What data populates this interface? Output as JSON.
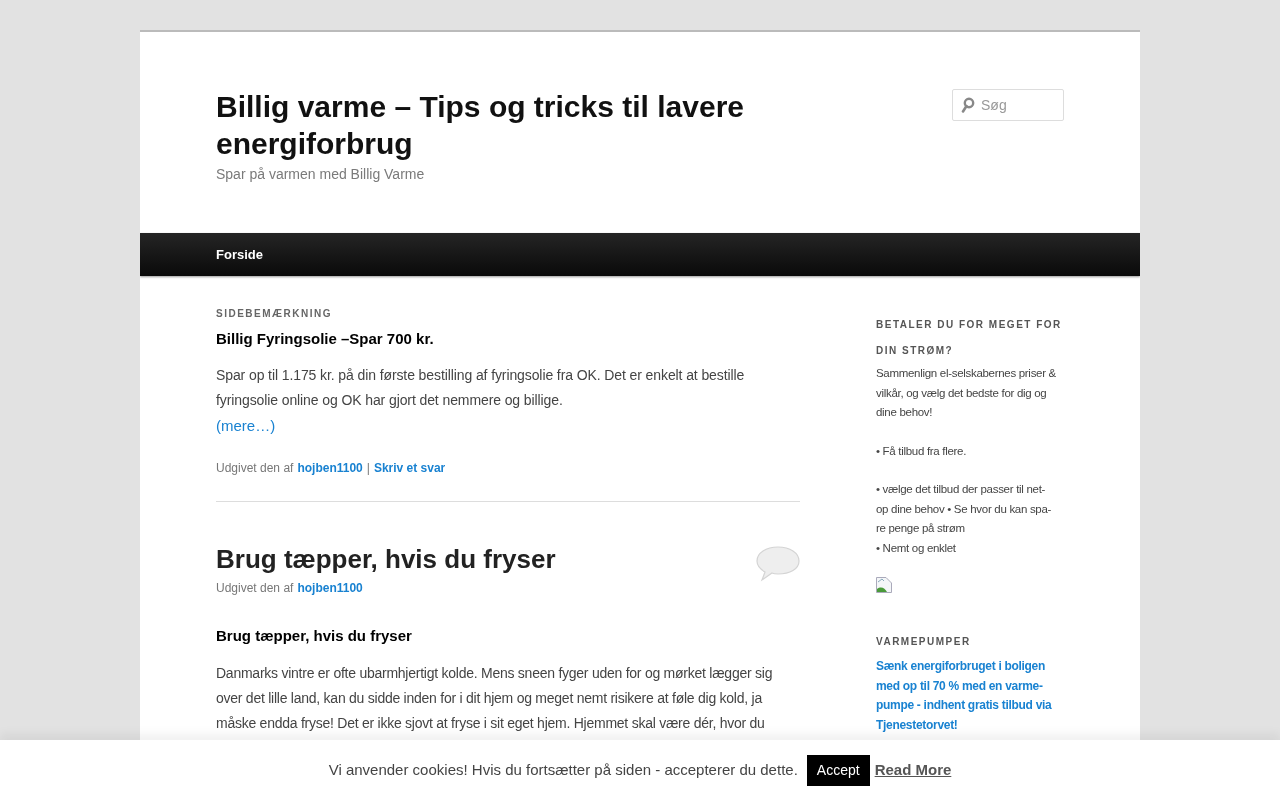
{
  "site": {
    "title": "Billig varme – Tips og tricks til lavere energiforbrug",
    "tagline": "Spar på varmen med Billig Varme"
  },
  "search": {
    "placeholder": "Søg"
  },
  "nav": [
    {
      "label": "Forside",
      "selected": false
    }
  ],
  "posts": [
    {
      "kind": "aside",
      "label": "SIDEBEMÆRKNING",
      "heading": "Billig Fyringsolie –Spar 700 kr.",
      "body": [
        "Spar op til 1.175 kr. på din første bestilling af fyringsolie fra OK. Det er enkelt at bestille fyringsolie online og OK har gjort det nemmere og billige."
      ],
      "more": "(mere…)",
      "meta": "Udgivet den af",
      "author": "hojben1100",
      "separator": "|",
      "reply": "Skriv et svar"
    },
    {
      "kind": "standard",
      "title": "Brug tæpper, hvis du fryser",
      "meta": "Udgivet den af",
      "author": "hojben1100",
      "heading": "Brug tæpper, hvis du fryser",
      "body": [
        "Danmarks vintre er ofte ubarmhjertigt kolde. Mens sneen fyger uden for og mørket lægger sig over det lille land, kan du sidde inden for i dit hjem og meget nemt risikere at føle dig kold, ja måske endda fryse! Det er ikke sjovt at fryse i sit eget hjem. Hjemmet skal være dér, hvor du"
      ]
    }
  ],
  "widgets": [
    {
      "kind": "text",
      "title": "BETALER DU FOR MEGET FOR DIN STRØM?",
      "paragraphs": [
        "Sammenlign el-selskabernes priser & vilkår, og vælg det bedste for dig og dine behov!",
        "• Få tilbud fra flere.",
        "• vælge det tilbud der passer til net-\nop dine behov • Se hvor du kan spa-\nre penge på strøm\n• Nemt og enklet"
      ],
      "broken_image": true
    },
    {
      "kind": "link",
      "title": "VARMEPUMPER",
      "link": "Sænk energiforbruget i boligen med op til 70 % med en varme-\npumpe - indhent gratis tilbud via Tjenestetorvet!"
    }
  ],
  "cookie_bar": {
    "message": "Vi anvender cookies! Hvis du fortsætter på siden - accepterer du dette.",
    "accept": "Accept",
    "read_more": "Read More"
  }
}
